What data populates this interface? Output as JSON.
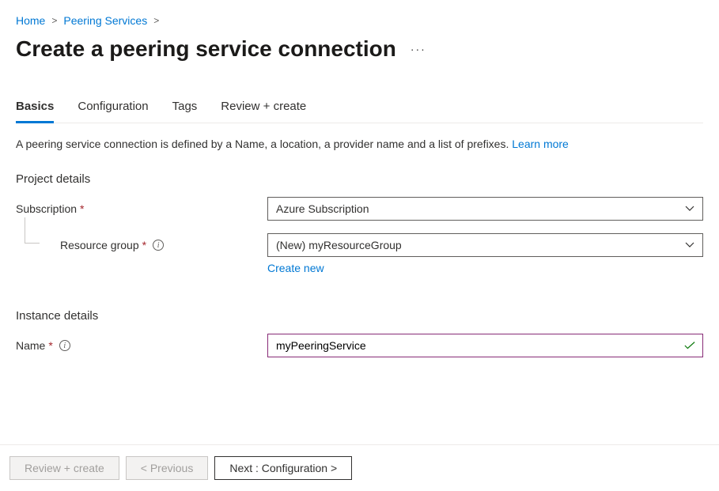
{
  "breadcrumb": {
    "home": "Home",
    "peering": "Peering Services"
  },
  "page": {
    "title": "Create a peering service connection"
  },
  "tabs": {
    "basics": "Basics",
    "configuration": "Configuration",
    "tags": "Tags",
    "review": "Review + create"
  },
  "description": {
    "text": "A peering service connection is defined by a Name, a location, a provider name and a list of prefixes. ",
    "learn_more": "Learn more"
  },
  "sections": {
    "project_details": "Project details",
    "instance_details": "Instance details"
  },
  "fields": {
    "subscription": {
      "label": "Subscription",
      "value": "Azure Subscription"
    },
    "resource_group": {
      "label": "Resource group",
      "value": "(New) myResourceGroup",
      "create_new": "Create new"
    },
    "name": {
      "label": "Name",
      "value": "myPeeringService"
    }
  },
  "footer": {
    "review": "Review + create",
    "previous": "< Previous",
    "next": "Next : Configuration >"
  }
}
